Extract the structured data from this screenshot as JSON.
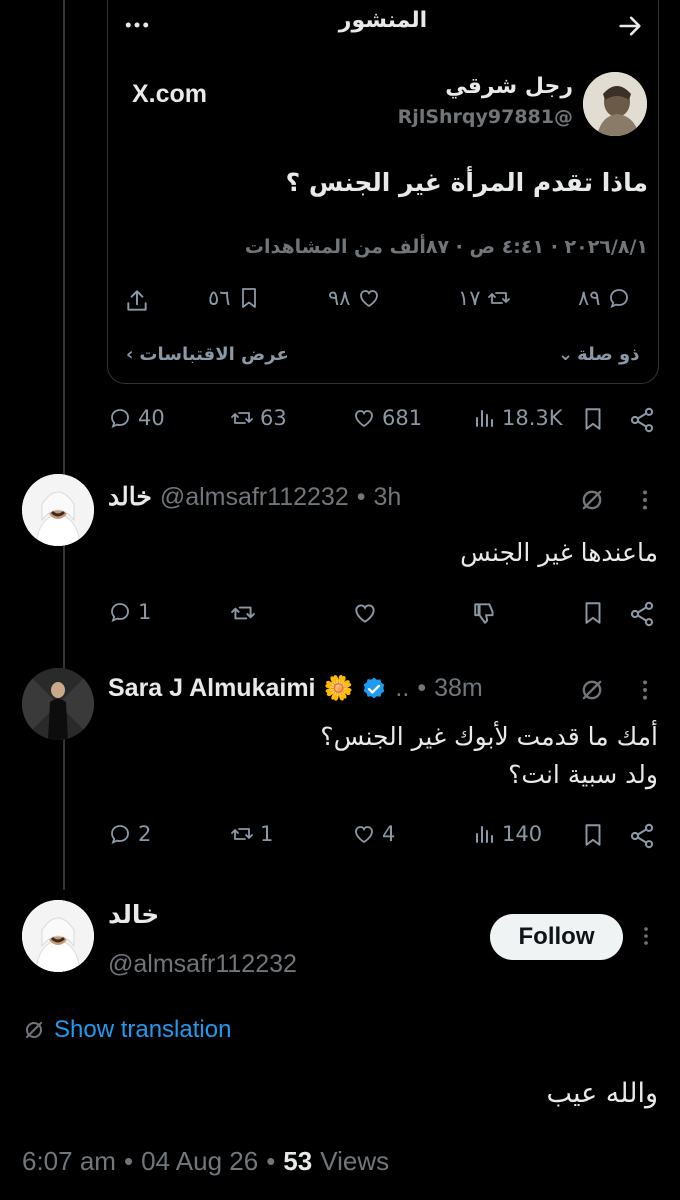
{
  "quoted_post": {
    "header_title": "المنشور",
    "author_name": "رجل شرقي",
    "author_handle": "@RjlShrqy97881",
    "site_label": "X.com",
    "text": "ماذا تقدم المرأة غير الجنس ؟",
    "meta": "٢٠٢٦/٨/١ · ٤:٤١ ص · ٨٧ألف من المشاهدات",
    "stats": {
      "replies": "٨٩",
      "reposts": "١٧",
      "likes": "٩٨",
      "bookmarks": "٥٦"
    },
    "related_label": "ذو صلة",
    "quotes_label": "عرض الاقتباسات"
  },
  "main_post_stats": {
    "replies": "40",
    "reposts": "63",
    "likes": "681",
    "views": "18.3K"
  },
  "reply1": {
    "name": "خالد",
    "handle": "@almsafr112232",
    "time": "3h",
    "text": "ماعندها غير الجنس",
    "stats": {
      "replies": "1"
    }
  },
  "reply2": {
    "name": "Sara J Almukaimi",
    "emoji": "🌼",
    "dots": "..",
    "time": "38m",
    "line1": "أمك ما قدمت لأبوك غير الجنس؟",
    "line2": "ولد سبية انت؟",
    "stats": {
      "replies": "2",
      "reposts": "1",
      "likes": "4",
      "views": "140"
    }
  },
  "focused": {
    "name": "خالد",
    "handle": "@almsafr112232",
    "follow_label": "Follow",
    "translate_label": "Show translation",
    "text": "والله عيب",
    "time": "6:07 am",
    "date": "04 Aug 26",
    "views_count": "53",
    "views_label": "Views"
  },
  "colors": {
    "background": "#000000",
    "text": "#e7e9ea",
    "muted": "#71767b",
    "link": "#1d9bf0",
    "verified": "#1d9bf0"
  }
}
